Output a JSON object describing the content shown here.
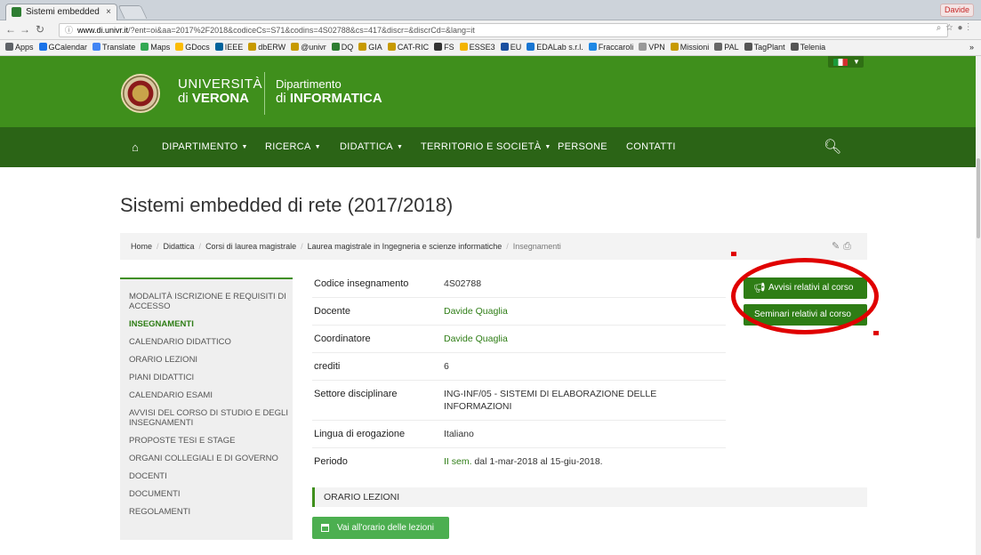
{
  "browser": {
    "tab_title": "Sistemi embedded",
    "tab_close": "×",
    "user": "Davide",
    "url_host": "www.di.univr.it",
    "url_path": "/?ent=oi&aa=2017%2F2018&codiceCs=S71&codins=4S02788&cs=417&discr=&discrCd=&lang=it",
    "bookmarks": [
      {
        "label": "Apps",
        "color": "#5f6368"
      },
      {
        "label": "GCalendar",
        "color": "#1a73e8"
      },
      {
        "label": "Translate",
        "color": "#4285f4"
      },
      {
        "label": "Maps",
        "color": "#34a853"
      },
      {
        "label": "GDocs",
        "color": "#fbbc04"
      },
      {
        "label": "IEEE",
        "color": "#00629b"
      },
      {
        "label": "dbERW",
        "color": "#c79a00"
      },
      {
        "label": "@univr",
        "color": "#c79a00"
      },
      {
        "label": "DQ",
        "color": "#2e7d32"
      },
      {
        "label": "GIA",
        "color": "#c79a00"
      },
      {
        "label": "CAT-RIC",
        "color": "#c79a00"
      },
      {
        "label": "FS",
        "color": "#333333"
      },
      {
        "label": "ESSE3",
        "color": "#f4b400"
      },
      {
        "label": "EU",
        "color": "#1a4fa0"
      },
      {
        "label": "EDALab s.r.l.",
        "color": "#1976d2"
      },
      {
        "label": "Fraccaroli",
        "color": "#1e88e5"
      },
      {
        "label": "VPN",
        "color": "#999999"
      },
      {
        "label": "Missioni",
        "color": "#c79a00"
      },
      {
        "label": "PAL",
        "color": "#666666"
      },
      {
        "label": "TagPlant",
        "color": "#555555"
      },
      {
        "label": "Telenia",
        "color": "#555555"
      }
    ],
    "bookmarks_more": "»"
  },
  "header": {
    "university_line1": "UNIVERSITÀ",
    "university_line2_prefix": "di ",
    "university_line2_bold": "VERONA",
    "department_line1": "Dipartimento",
    "department_line2_prefix": "di ",
    "department_line2_bold": "INFORMATICA"
  },
  "nav": {
    "items": [
      {
        "label": "DIPARTIMENTO",
        "dropdown": true
      },
      {
        "label": "RICERCA",
        "dropdown": true
      },
      {
        "label": "DIDATTICA",
        "dropdown": true
      },
      {
        "label": "TERRITORIO E SOCIETÀ",
        "dropdown": true
      },
      {
        "label": "PERSONE",
        "dropdown": false
      },
      {
        "label": "CONTATTI",
        "dropdown": false
      }
    ]
  },
  "page": {
    "title": "Sistemi embedded di rete (2017/2018)",
    "breadcrumb": [
      "Home",
      "Didattica",
      "Corsi di laurea magistrale",
      "Laurea magistrale in Ingegneria e scienze informatiche",
      "Insegnamenti"
    ]
  },
  "sidebar": {
    "items": [
      {
        "label": "MODALITÀ ISCRIZIONE E REQUISITI DI ACCESSO",
        "active": false
      },
      {
        "label": "INSEGNAMENTI",
        "active": true
      },
      {
        "label": "CALENDARIO DIDATTICO",
        "active": false
      },
      {
        "label": "ORARIO LEZIONI",
        "active": false
      },
      {
        "label": "PIANI DIDATTICI",
        "active": false
      },
      {
        "label": "CALENDARIO ESAMI",
        "active": false
      },
      {
        "label": "AVVISI DEL CORSO DI STUDIO E DEGLI INSEGNAMENTI",
        "active": false
      },
      {
        "label": "PROPOSTE TESI E STAGE",
        "active": false
      },
      {
        "label": "ORGANI COLLEGIALI E DI GOVERNO",
        "active": false
      },
      {
        "label": "DOCENTI",
        "active": false
      },
      {
        "label": "DOCUMENTI",
        "active": false
      },
      {
        "label": "REGOLAMENTI",
        "active": false
      }
    ]
  },
  "details": {
    "codice_label": "Codice insegnamento",
    "codice_value": "4S02788",
    "docente_label": "Docente",
    "docente_value": "Davide Quaglia",
    "coordinatore_label": "Coordinatore",
    "coordinatore_value": "Davide Quaglia",
    "crediti_label": "crediti",
    "crediti_value": "6",
    "settore_label": "Settore disciplinare",
    "settore_value": "ING-INF/05 - SISTEMI DI ELABORAZIONE DELLE INFORMAZIONI",
    "lingua_label": "Lingua di erogazione",
    "lingua_value": "Italiano",
    "periodo_label": "Periodo",
    "periodo_sem": "II sem.",
    "periodo_range": " dal 1-mar-2018 al 15-giu-2018."
  },
  "schedule": {
    "section_title": "ORARIO LEZIONI",
    "button_label": "Vai all'orario delle lezioni"
  },
  "actions": {
    "avvisi_label": "Avvisi relativi al corso",
    "seminari_label": "Seminari relativi al corso"
  },
  "colors": {
    "brand_green": "#3f8f1c",
    "nav_green": "#2b6416",
    "link_green": "#2e7d15",
    "annotation_red": "#e00000"
  }
}
